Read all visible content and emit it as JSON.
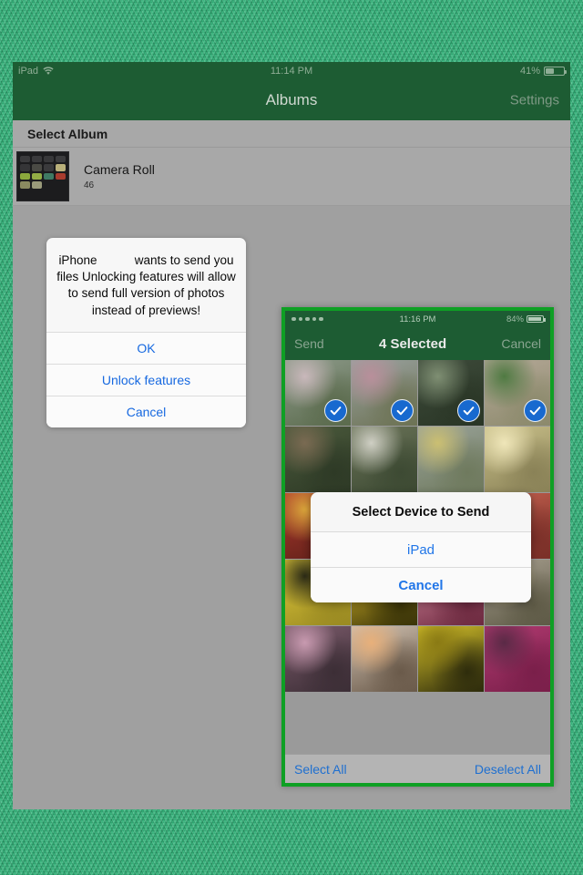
{
  "ipad": {
    "status_bar": {
      "device_label": "iPad",
      "wifi_icon": "wifi-icon",
      "time": "11:14 PM",
      "battery_percent": "41%",
      "battery_level": 41
    },
    "nav": {
      "title": "Albums",
      "right_button": "Settings"
    },
    "section_header": "Select Album",
    "albums": [
      {
        "name": "Camera Roll",
        "count": "46"
      }
    ]
  },
  "ipad_alert": {
    "message": "iPhone           wants to send you files Unlocking features will allow to send full version of photos instead of previews!",
    "buttons": [
      {
        "label": "OK"
      },
      {
        "label": "Unlock features"
      },
      {
        "label": "Cancel"
      }
    ]
  },
  "iphone": {
    "status_bar": {
      "signal_dots": 5,
      "time": "11:16 PM",
      "battery_percent": "84%",
      "battery_level": 84
    },
    "nav": {
      "left_button": "Send",
      "title": "4 Selected",
      "right_button": "Cancel"
    },
    "toolbar": {
      "left_button": "Select All",
      "right_button": "Deselect All"
    },
    "photos": [
      {
        "selected": true,
        "c1": "#8d9a8a",
        "c2": "#c9b8bb",
        "c3": "#5b6b4d"
      },
      {
        "selected": true,
        "c1": "#9aa2a0",
        "c2": "#b98f9b",
        "c3": "#6d7355"
      },
      {
        "selected": true,
        "c1": "#3d4a3a",
        "c2": "#7f8f73",
        "c3": "#2a3626"
      },
      {
        "selected": true,
        "c1": "#b5a898",
        "c2": "#4f7a42",
        "c3": "#8c8a6c"
      },
      {
        "selected": false,
        "c1": "#4b5a3c",
        "c2": "#7a6a52",
        "c3": "#2e3a26"
      },
      {
        "selected": false,
        "c1": "#6a7358",
        "c2": "#cfcfc4",
        "c3": "#3d4a33"
      },
      {
        "selected": false,
        "c1": "#9aa39a",
        "c2": "#cbbf72",
        "c3": "#6f7a5e"
      },
      {
        "selected": false,
        "c1": "#c9c08a",
        "c2": "#efe6b9",
        "c3": "#8a8257"
      },
      {
        "selected": false,
        "c1": "#b03a2e",
        "c2": "#d9a43a",
        "c3": "#5c1f18"
      },
      {
        "selected": false,
        "c1": "#d8b83a",
        "c2": "#e8e0c8",
        "c3": "#8a6f22"
      },
      {
        "selected": false,
        "c1": "#b24a66",
        "c2": "#2f5a62",
        "c3": "#6d2338"
      },
      {
        "selected": false,
        "c1": "#c2604e",
        "c2": "#3b5a3e",
        "c3": "#7a2f28"
      },
      {
        "selected": false,
        "c1": "#e0c93a",
        "c2": "#2b2a16",
        "c3": "#9a8a22"
      },
      {
        "selected": false,
        "c1": "#e5c22c",
        "c2": "#8a7a18",
        "c3": "#3a3408"
      },
      {
        "selected": false,
        "c1": "#d88aa0",
        "c2": "#a8324e",
        "c3": "#6d2a40"
      },
      {
        "selected": false,
        "c1": "#a8a090",
        "c2": "#d4c68a",
        "c3": "#5e5a46"
      },
      {
        "selected": false,
        "c1": "#7a5a6a",
        "c2": "#c89ab0",
        "c3": "#3c2e36"
      },
      {
        "selected": false,
        "c1": "#cfc0b0",
        "c2": "#e8b07a",
        "c3": "#6a5a4a"
      },
      {
        "selected": false,
        "c1": "#d6c22a",
        "c2": "#8a7a14",
        "c3": "#2e2c0c"
      },
      {
        "selected": false,
        "c1": "#b03a70",
        "c2": "#5a2a46",
        "c3": "#7a1f4a"
      }
    ]
  },
  "iphone_alert": {
    "title": "Select Device to Send",
    "buttons": [
      {
        "label": "iPad",
        "bold": false
      },
      {
        "label": "Cancel",
        "bold": true
      }
    ]
  }
}
